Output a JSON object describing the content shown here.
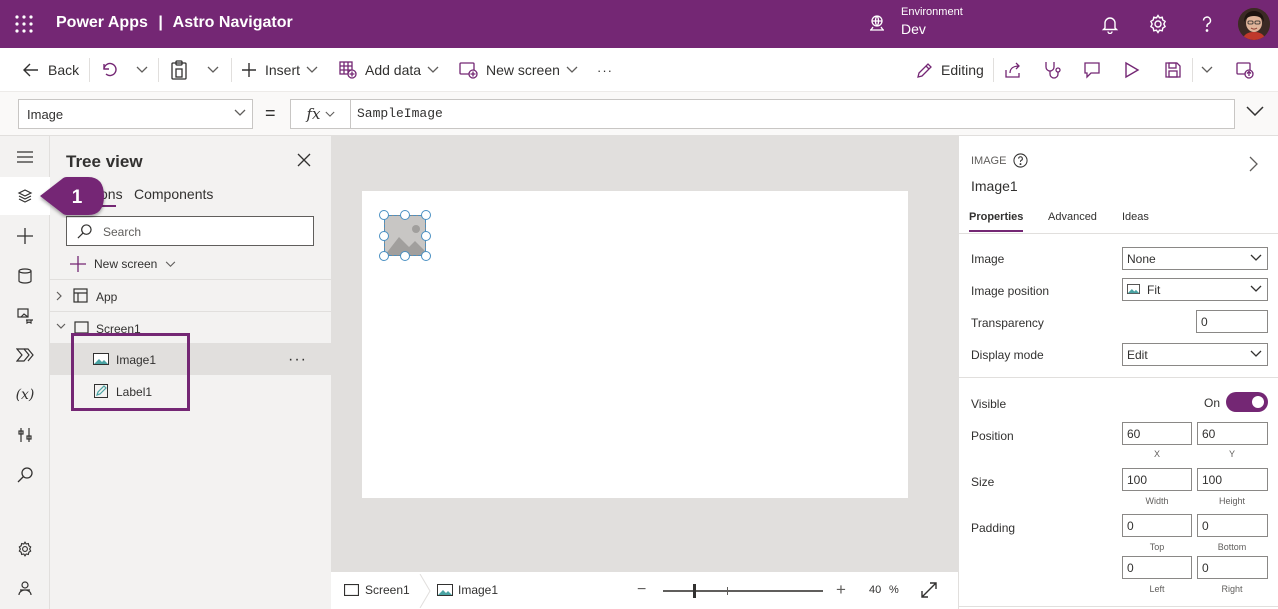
{
  "header": {
    "app_name": "Power Apps",
    "separator": "|",
    "app_title": "Astro Navigator",
    "environment_label": "Environment",
    "environment_value": "Dev",
    "icons": [
      "waffle-icon",
      "environment-icon",
      "bell-icon",
      "gear-icon",
      "help-icon",
      "avatar"
    ]
  },
  "toolbar": {
    "back": "Back",
    "insert": "Insert",
    "add_data": "Add data",
    "new_screen": "New screen",
    "more": "···",
    "editing": "Editing"
  },
  "formula_bar": {
    "property": "Image",
    "equals": "=",
    "fx": "fx",
    "formula": "SampleImage"
  },
  "tree_view": {
    "title": "Tree view",
    "tabs": [
      "ons",
      "Components"
    ],
    "search_placeholder": "Search",
    "new_screen": "New screen",
    "items": [
      {
        "label": "App"
      },
      {
        "label": "Screen1"
      },
      {
        "label": "Image1"
      },
      {
        "label": "Label1"
      }
    ],
    "row_more": "···",
    "callout_number": "1"
  },
  "bottom_bar": {
    "crumb_screen": "Screen1",
    "crumb_image": "Image1",
    "zoom_minus": "−",
    "zoom_plus": "+",
    "zoom_value": "40",
    "zoom_unit": "%"
  },
  "properties": {
    "type": "IMAGE",
    "name": "Image1",
    "tabs": [
      "Properties",
      "Advanced",
      "Ideas"
    ],
    "image_label": "Image",
    "image_value": "None",
    "image_position_label": "Image position",
    "image_position_value": "Fit",
    "transparency_label": "Transparency",
    "transparency_value": "0",
    "display_mode_label": "Display mode",
    "display_mode_value": "Edit",
    "visible_label": "Visible",
    "visible_state": "On",
    "position_label": "Position",
    "position_x": "60",
    "position_y": "60",
    "x_caption": "X",
    "y_caption": "Y",
    "size_label": "Size",
    "width": "100",
    "height": "100",
    "width_caption": "Width",
    "height_caption": "Height",
    "padding_label": "Padding",
    "padding_top": "0",
    "padding_bottom": "0",
    "padding_left": "0",
    "padding_right": "0",
    "top_caption": "Top",
    "bottom_caption": "Bottom",
    "left_caption": "Left",
    "right_caption": "Right"
  },
  "colors": {
    "brand": "#742774",
    "selection": "#4a90c2"
  }
}
